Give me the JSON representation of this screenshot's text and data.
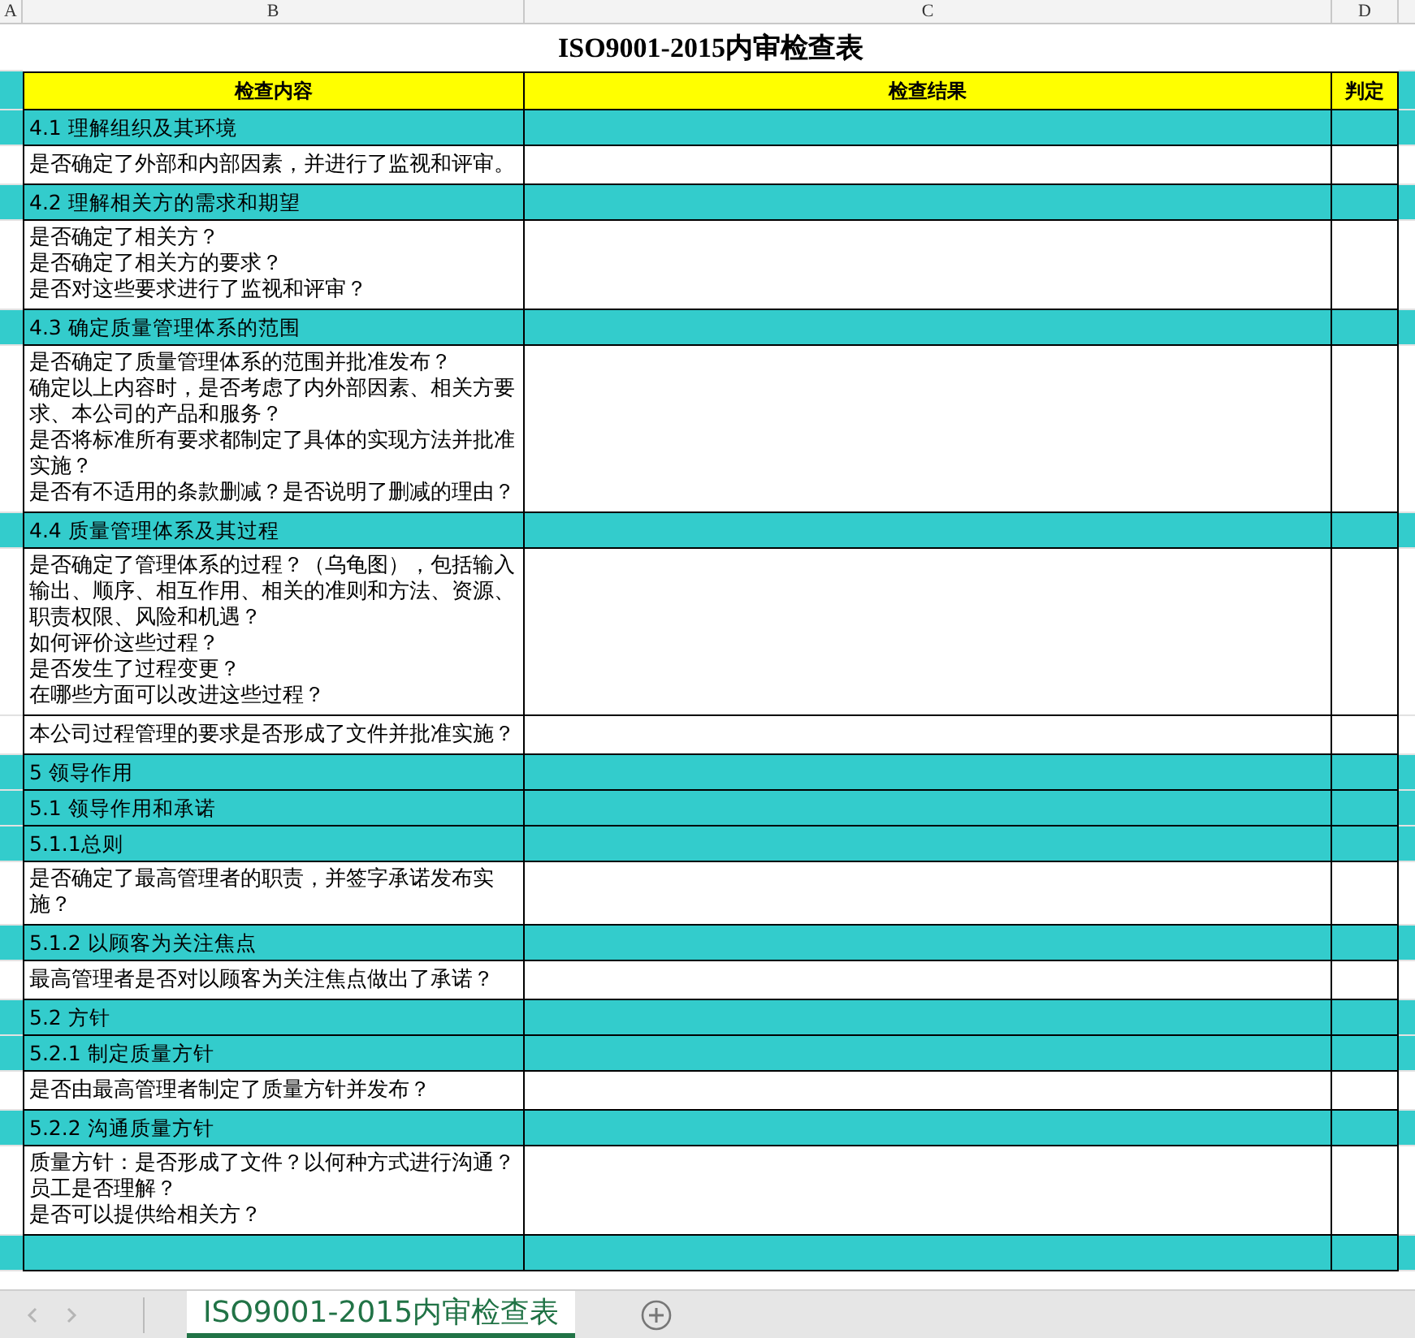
{
  "column_headers": [
    "A",
    "B",
    "C",
    "D"
  ],
  "title": "ISO9001-2015内审检查表",
  "table": {
    "columns": [
      "检查内容",
      "检查结果",
      "判定"
    ],
    "rows": [
      {
        "kind": "section",
        "text": "4.1 理解组织及其环境"
      },
      {
        "kind": "question",
        "lines": [
          "是否确定了外部和内部因素，并进行了监视和评审。"
        ]
      },
      {
        "kind": "section",
        "text": "4.2 理解相关方的需求和期望"
      },
      {
        "kind": "question",
        "lines": [
          "是否确定了相关方？",
          "是否确定了相关方的要求？",
          "是否对这些要求进行了监视和评审？"
        ]
      },
      {
        "kind": "section",
        "text": "4.3 确定质量管理体系的范围"
      },
      {
        "kind": "question",
        "lines": [
          "是否确定了质量管理体系的范围并批准发布？",
          "确定以上内容时，是否考虑了内外部因素、相关方要求、本公司的产品和服务？",
          "是否将标准所有要求都制定了具体的实现方法并批准实施？",
          "是否有不适用的条款删减？是否说明了删减的理由？"
        ]
      },
      {
        "kind": "section",
        "text": "4.4 质量管理体系及其过程"
      },
      {
        "kind": "question",
        "lines": [
          "是否确定了管理体系的过程？（乌龟图），包括输入输出、顺序、相互作用、相关的准则和方法、资源、职责权限、风险和机遇？",
          "如何评价这些过程？",
          "是否发生了过程变更？",
          "在哪些方面可以改进这些过程？"
        ]
      },
      {
        "kind": "question",
        "lines": [
          "本公司过程管理的要求是否形成了文件并批准实施？"
        ]
      },
      {
        "kind": "section",
        "text": "5 领导作用"
      },
      {
        "kind": "section",
        "text": "5.1 领导作用和承诺"
      },
      {
        "kind": "section",
        "text": "5.1.1总则"
      },
      {
        "kind": "question",
        "lines": [
          "是否确定了最高管理者的职责，并签字承诺发布实施？"
        ]
      },
      {
        "kind": "section",
        "text": "5.1.2  以顾客为关注焦点"
      },
      {
        "kind": "question",
        "lines": [
          "最高管理者是否对以顾客为关注焦点做出了承诺？"
        ]
      },
      {
        "kind": "section",
        "text": "5.2 方针"
      },
      {
        "kind": "section",
        "text": "5.2.1 制定质量方针"
      },
      {
        "kind": "question",
        "lines": [
          "是否由最高管理者制定了质量方针并发布？"
        ]
      },
      {
        "kind": "section",
        "text": "5.2.2 沟通质量方针"
      },
      {
        "kind": "question",
        "lines": [
          "质量方针：是否形成了文件？以何种方式进行沟通？",
          "员工是否理解？",
          "是否可以提供给相关方？"
        ]
      },
      {
        "kind": "section",
        "text": ""
      }
    ]
  },
  "sheet_tabs": [
    {
      "label": "ISO9001-2015内审检查表",
      "selected": true
    }
  ]
}
